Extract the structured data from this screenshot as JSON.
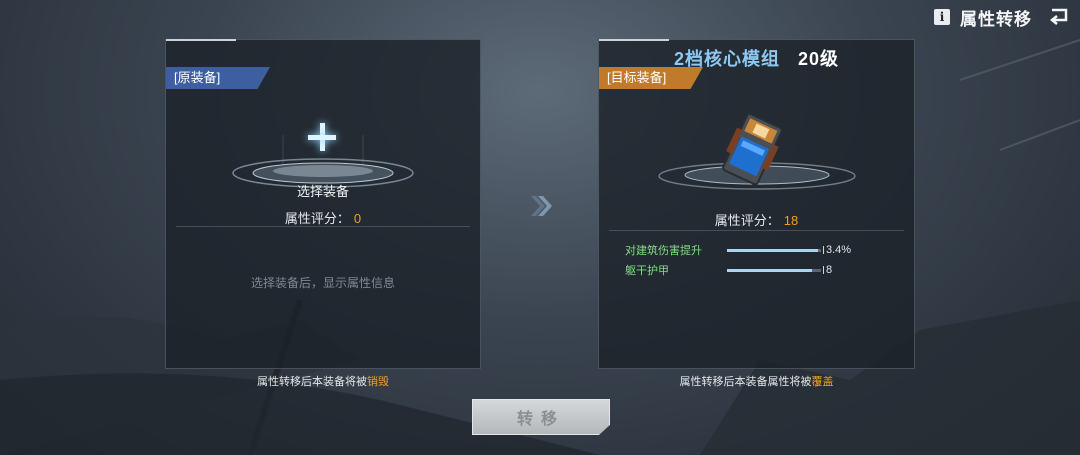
{
  "topbar": {
    "info_label": "i",
    "title": "属性转移"
  },
  "left_panel": {
    "tag": "[原装备]",
    "select_label": "选择装备",
    "score_label": "属性评分：",
    "score_value": "0",
    "empty_hint": "选择装备后，显示属性信息",
    "note_prefix": "属性转移后本装备将被",
    "note_warn": "销毁"
  },
  "right_panel": {
    "header_tier": "2档核心模组",
    "header_level": "20级",
    "tag": "[目标装备]",
    "score_label": "属性评分：",
    "score_value": "18",
    "stats": [
      {
        "name": "对建筑伤害提升",
        "value": "3.4%",
        "fill": 0.97
      },
      {
        "name": "躯干护甲",
        "value": "8",
        "fill": 0.9
      }
    ],
    "note_prefix": "属性转移后本装备属性将被",
    "note_warn": "覆盖"
  },
  "transfer_button": {
    "label": "转移"
  },
  "icons": {
    "info": "info-icon",
    "back": "back-icon",
    "plus": "plus-icon",
    "arrow": "double-chevron-right-icon",
    "item": "core-module-icon"
  },
  "colors": {
    "accent_orange": "#f0a020",
    "tag_blue": "#3d5fa0",
    "tag_orange": "#c17a2a",
    "stat_green": "#7fe07f",
    "header_blue": "#8ec8f0"
  }
}
